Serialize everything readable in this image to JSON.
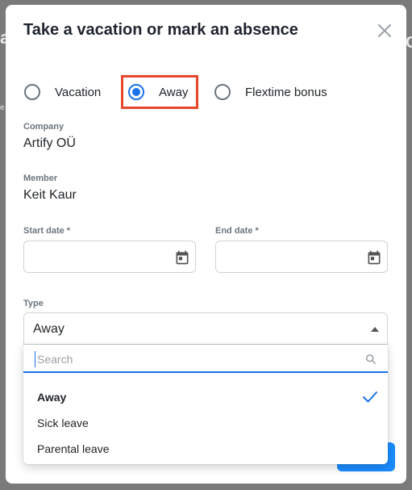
{
  "background": {
    "fragment_left": "a",
    "fragment_left2": "e",
    "fragment_right": "C"
  },
  "dialog": {
    "title": "Take a vacation or mark an absence"
  },
  "absence_kind": {
    "options": [
      {
        "label": "Vacation",
        "checked": false
      },
      {
        "label": "Away",
        "checked": true
      },
      {
        "label": "Flextime bonus",
        "checked": false
      }
    ]
  },
  "company": {
    "label": "Company",
    "value": "Artify OÜ"
  },
  "member": {
    "label": "Member",
    "value": "Keit Kaur"
  },
  "start_date": {
    "label": "Start date *",
    "value": ""
  },
  "end_date": {
    "label": "End date *",
    "value": ""
  },
  "type": {
    "label": "Type",
    "selected": "Away",
    "search_placeholder": "Search",
    "options": [
      {
        "label": "Away",
        "selected": true
      },
      {
        "label": "Sick leave",
        "selected": false
      },
      {
        "label": "Parental leave",
        "selected": false
      }
    ]
  },
  "colors": {
    "accent": "#1a73e8",
    "highlight": "#e8472a",
    "primary_button": "#1a8cff"
  }
}
